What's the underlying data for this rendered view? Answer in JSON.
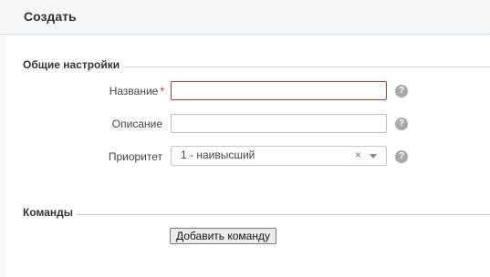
{
  "header": {
    "title": "Создать"
  },
  "general": {
    "legend": "Общие настройки",
    "name": {
      "label": "Название",
      "required_mark": "*",
      "value": ""
    },
    "description": {
      "label": "Описание",
      "value": ""
    },
    "priority": {
      "label": "Приоритет",
      "value": "1 - наивысший",
      "clear": "×"
    },
    "help_glyph": "?"
  },
  "commands": {
    "legend": "Команды",
    "add_button": "Добавить команду"
  },
  "colors": {
    "required": "#c03030",
    "invalid_border": "#c0392b",
    "help_icon": "#a9a9a9"
  }
}
